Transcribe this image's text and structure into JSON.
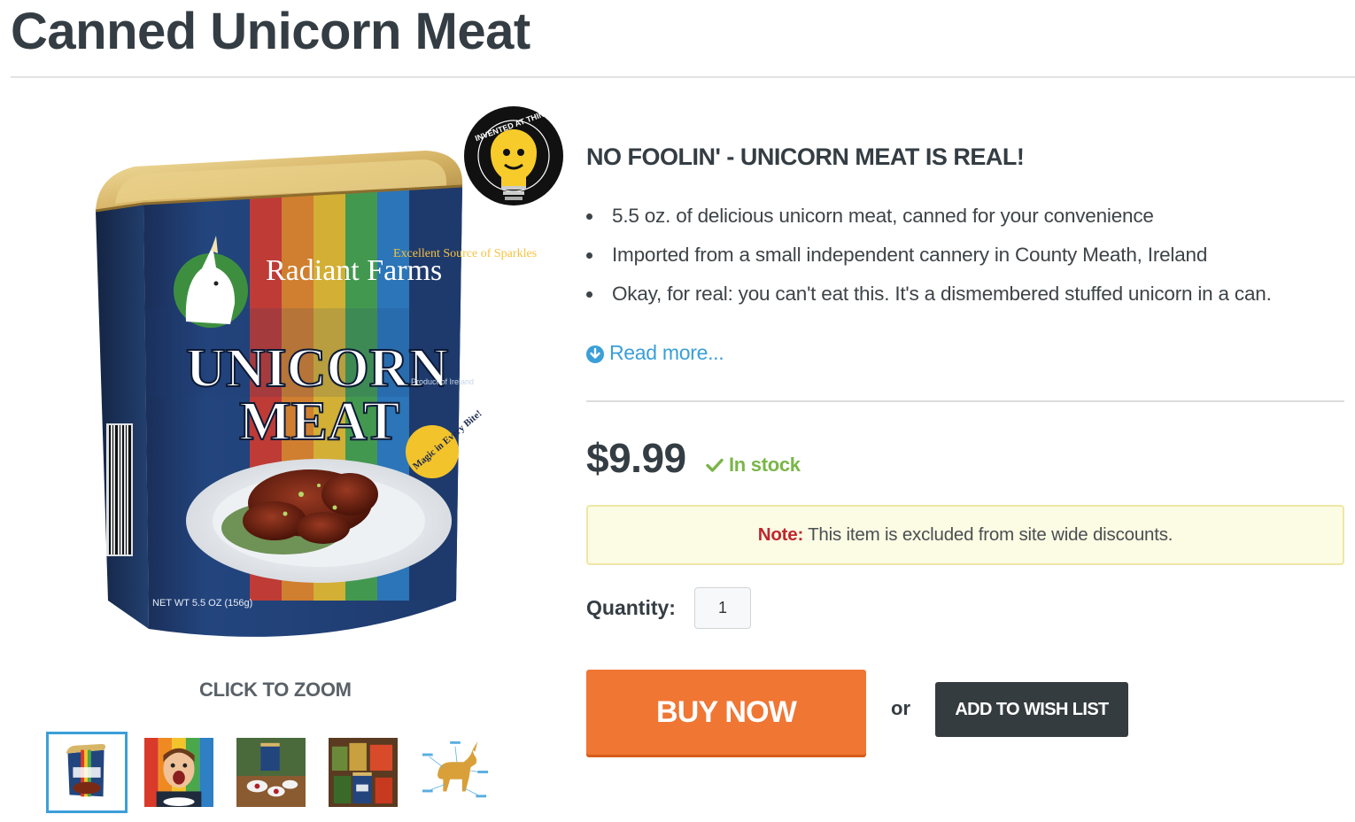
{
  "product": {
    "title": "Canned Unicorn Meat",
    "headline": "NO FOOLIN' - UNICORN MEAT IS REAL!",
    "features": [
      "5.5 oz. of delicious unicorn meat, canned for your convenience",
      "Imported from a small independent cannery in County Meath, Ireland",
      "Okay, for real: you can't eat this. It's a dismembered stuffed unicorn in a can."
    ],
    "read_more": "Read more...",
    "price": "$9.99",
    "stock": "In stock",
    "note_label": "Note:",
    "note_text": "This item is excluded from site wide discounts.",
    "quantity_label": "Quantity:",
    "quantity_value": "1",
    "buy_label": "BUY NOW",
    "or_text": "or",
    "wishlist_label": "ADD TO WISH LIST"
  },
  "gallery": {
    "zoom_label": "CLICK TO ZOOM",
    "can_brand": "Radiant Farms",
    "can_line1": "UNICORN",
    "can_line2": "MEAT",
    "can_tagline": "Excellent Source of Sparkles",
    "can_badge": "Magic in Every Bite!",
    "can_weight": "NET WT 5.5 OZ (156g)",
    "can_origin": "Product of Ireland",
    "seal_text": "INVENTED AT THINKGEEK",
    "thumbnails": [
      "can-front",
      "boy-eating",
      "can-opened",
      "can-shelf",
      "unicorn-diagram"
    ],
    "active_thumbnail": 0
  },
  "colors": {
    "accent_blue": "#3b9fd8",
    "buy_orange": "#f07633",
    "in_stock_green": "#7ab648",
    "note_red": "#c0262d",
    "wishlist_dark": "#353c40"
  },
  "icons": {
    "read_more": "circle-arrow-down-icon",
    "stock": "checkmark-icon",
    "seal": "lightbulb-monkey-icon"
  }
}
